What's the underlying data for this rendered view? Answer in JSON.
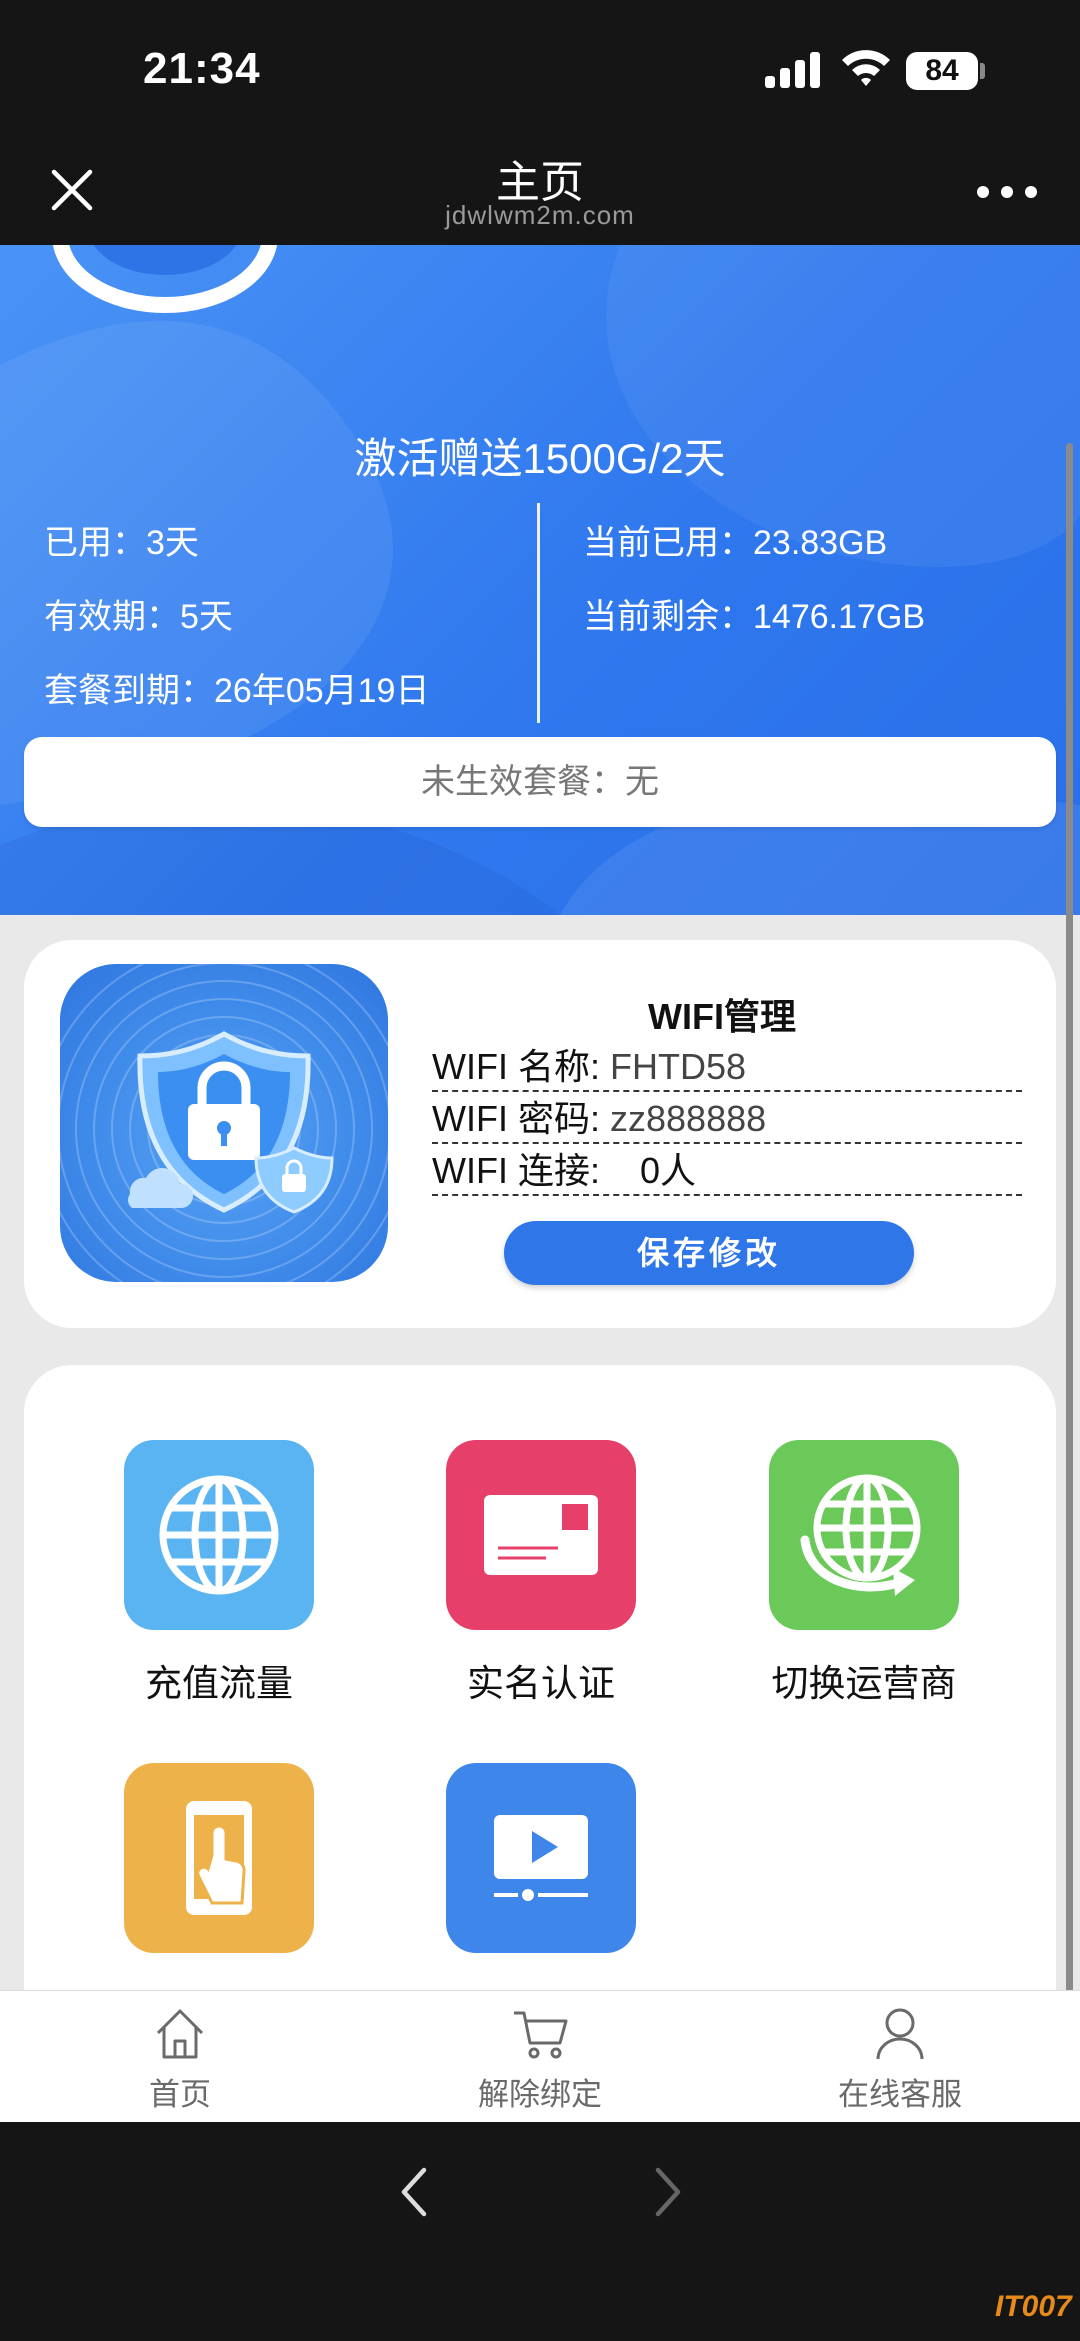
{
  "status_bar": {
    "time": "21:34",
    "battery": "84"
  },
  "nav": {
    "title": "主页",
    "url": "jdwlwm2m.com"
  },
  "hero": {
    "title": "激活赠送1500G/2天",
    "used_days": "已用：3天",
    "validity": "有效期：5天",
    "expiry": "套餐到期：26年05月19日",
    "current_used": "当前已用：23.83GB",
    "current_remaining": "当前剩余：1476.17GB",
    "pending_plan": "未生效套餐：无"
  },
  "wifi": {
    "title": "WIFI管理",
    "name_label": "WIFI 名称:",
    "name_value": "FHTD58",
    "password_label": "WIFI 密码:",
    "password_value": "zz888888",
    "connected_label": "WIFI 连接:",
    "connected_value": "0人",
    "save_label": "保存修改"
  },
  "functions": [
    {
      "label": "充值流量",
      "icon": "globe-icon",
      "color": "#5ab4f1"
    },
    {
      "label": "实名认证",
      "icon": "id-card-icon",
      "color": "#e6406a"
    },
    {
      "label": "切换运营商",
      "icon": "globe-switch-icon",
      "color": "#6bc95a"
    },
    {
      "label": "",
      "icon": "phone-touch-icon",
      "color": "#eeb24a"
    },
    {
      "label": "",
      "icon": "video-icon",
      "color": "#3f86ea"
    }
  ],
  "tabs": [
    {
      "label": "首页",
      "icon": "home-icon"
    },
    {
      "label": "解除绑定",
      "icon": "cart-icon"
    },
    {
      "label": "在线客服",
      "icon": "user-icon"
    }
  ],
  "watermark": "IT007",
  "colors": {
    "primary": "#2f77e9",
    "page_bg": "#e9e9ea",
    "system_bar": "#151515"
  }
}
